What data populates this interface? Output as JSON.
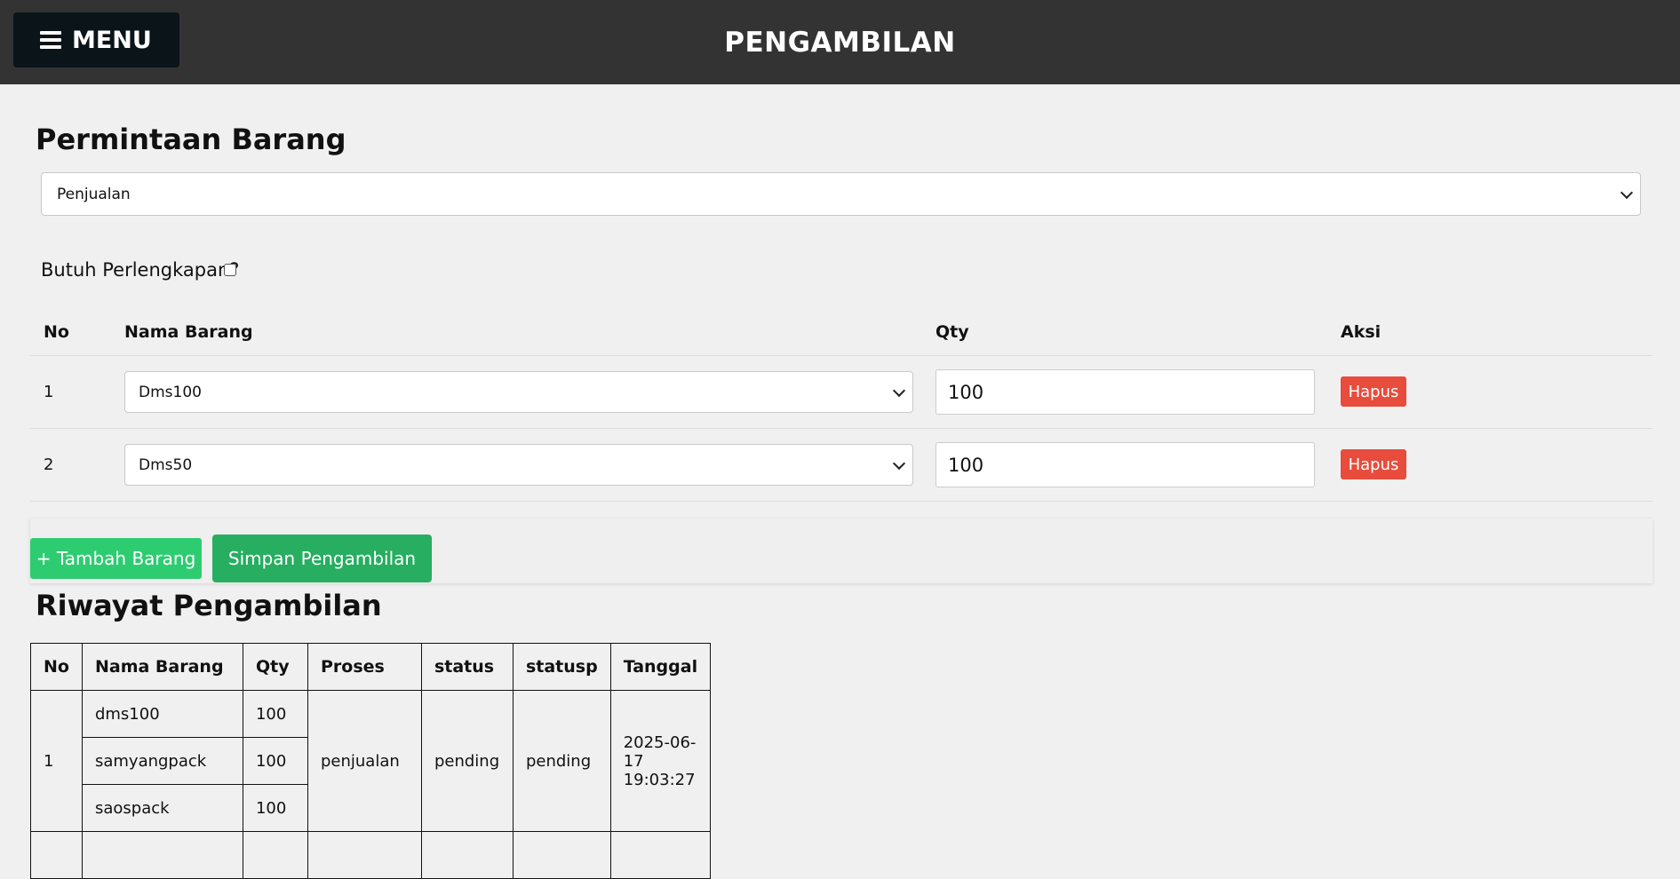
{
  "header": {
    "menu_label": "MENU",
    "title": "PENGAMBILAN"
  },
  "request": {
    "heading": "Permintaan Barang",
    "process_select": "Penjualan",
    "equipment_label": "Butuh Perlengkapan?",
    "columns": [
      "No",
      "Nama Barang",
      "Qty",
      "Aksi"
    ],
    "rows": [
      {
        "no": "1",
        "item": "Dms100",
        "qty": "100",
        "delete_label": "Hapus"
      },
      {
        "no": "2",
        "item": "Dms50",
        "qty": "100",
        "delete_label": "Hapus"
      }
    ],
    "add_label": "+ Tambah Barang",
    "save_label": "Simpan Pengambilan"
  },
  "history": {
    "heading": "Riwayat Pengambilan",
    "columns": [
      "No",
      "Nama Barang",
      "Qty",
      "Proses",
      "status",
      "statusp",
      "Tanggal"
    ],
    "entries": [
      {
        "no": "1",
        "items": [
          {
            "name": "dms100",
            "qty": "100"
          },
          {
            "name": "samyangpack",
            "qty": "100"
          },
          {
            "name": "saospack",
            "qty": "100"
          }
        ],
        "process": "penjualan",
        "status": "pending",
        "statusp": "pending",
        "date": "2025-06-17 19:03:27"
      }
    ]
  }
}
